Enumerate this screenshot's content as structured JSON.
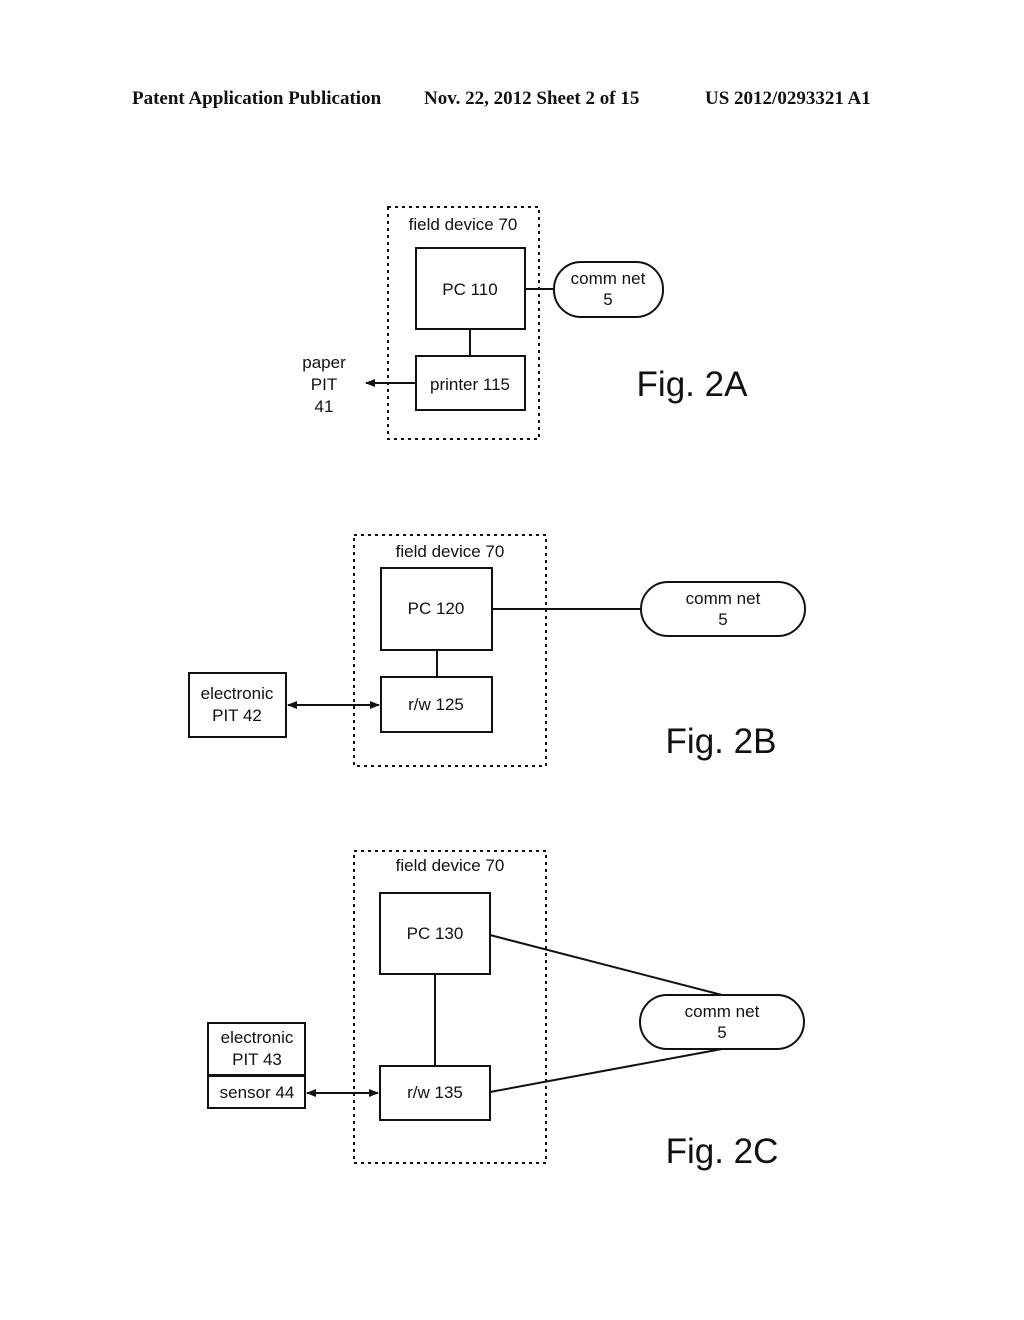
{
  "header": {
    "publication": "Patent Application Publication",
    "date_sheet": "Nov. 22, 2012   Sheet 2 of 15",
    "number": "US 2012/0293321 A1"
  },
  "fig2a": {
    "container": "field device 70",
    "pc": "PC 110",
    "printer": "printer 115",
    "comm_line1": "comm net",
    "comm_line2": "5",
    "output_line1": "paper",
    "output_line2": "PIT",
    "output_line3": "41",
    "caption": "Fig. 2A"
  },
  "fig2b": {
    "container": "field device 70",
    "pc": "PC 120",
    "rw": "r/w 125",
    "comm_line1": "comm net",
    "comm_line2": "5",
    "pit_line1": "electronic",
    "pit_line2": "PIT 42",
    "caption": "Fig. 2B"
  },
  "fig2c": {
    "container": "field device 70",
    "pc": "PC 130",
    "rw": "r/w 135",
    "comm_line1": "comm net",
    "comm_line2": "5",
    "pit_line1": "electronic",
    "pit_line2": "PIT 43",
    "sensor": "sensor 44",
    "caption": "Fig. 2C"
  }
}
